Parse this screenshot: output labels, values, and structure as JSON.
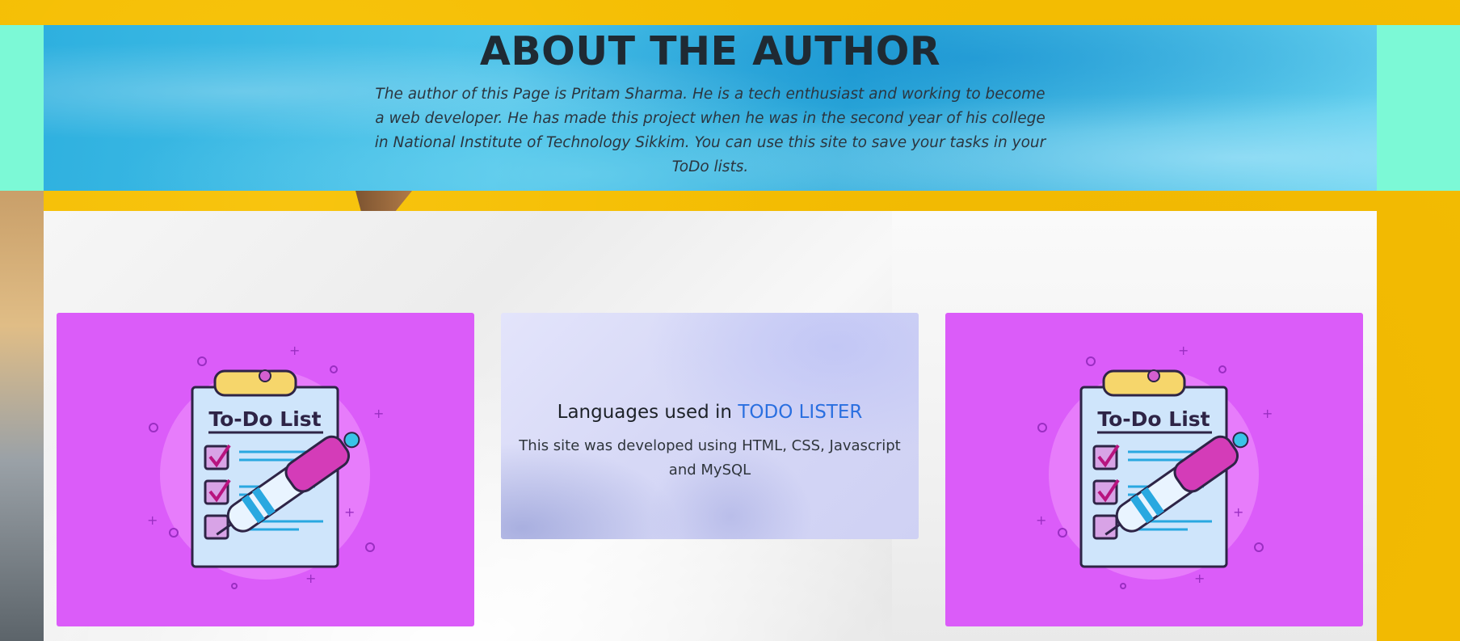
{
  "hero": {
    "title": "ABOUT THE AUTHOR",
    "description": "The author of this Page is Pritam Sharma. He is a tech enthusiast and working to become a web developer. He has made this project when he was in the second year of his college in National Institute of Technology Sikkim. You can use this site to save your tasks in your ToDo lists."
  },
  "cards": {
    "left": {
      "image_title": "To-Do List",
      "icon": "todo-list-clipboard-illustration"
    },
    "middle": {
      "heading_prefix": "Languages used in",
      "heading_accent": "TODO LISTER",
      "body": "This site was developed using HTML, CSS, Javascript and MySQL"
    },
    "right": {
      "image_title": "To-Do List",
      "icon": "todo-list-clipboard-illustration"
    }
  },
  "colors": {
    "background": "#f4bd02",
    "band": "#7cf9d6",
    "card_magenta": "#db5cf9",
    "accent_blue": "#2a6fe0"
  }
}
